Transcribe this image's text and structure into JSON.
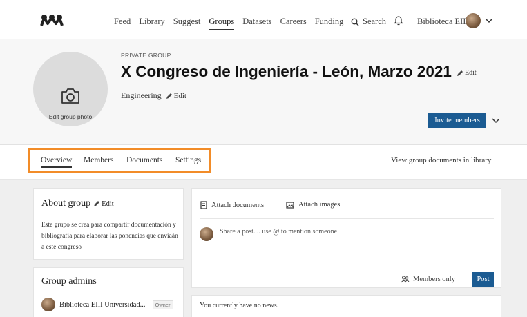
{
  "nav": {
    "links": [
      "Feed",
      "Library",
      "Suggest",
      "Groups",
      "Datasets",
      "Careers",
      "Funding"
    ],
    "active": "Groups",
    "search_label": "Search",
    "user_name": "Biblioteca EIII"
  },
  "header": {
    "photo_label": "Edit group photo",
    "privacy": "PRIVATE GROUP",
    "title": "X Congreso de Ingeniería - León, Marzo 2021",
    "title_edit": "Edit",
    "category": "Engineering",
    "category_edit": "Edit",
    "invite_label": "Invite members"
  },
  "tabs": {
    "items": [
      "Overview",
      "Members",
      "Documents",
      "Settings"
    ],
    "active": "Overview",
    "view_library": "View group documents in library",
    "highlight_color": "#f28c28"
  },
  "about": {
    "title": "About group",
    "edit": "Edit",
    "text": "Este grupo se crea para compartir documentación y bibliografía para elaborar las ponencias que enviaán a este congreso"
  },
  "admins": {
    "title": "Group admins",
    "name": "Biblioteca EIII Universidad...",
    "role": "Owner"
  },
  "post": {
    "attach_documents": "Attach documents",
    "attach_images": "Attach images",
    "placeholder": "Share a post.... use @ to mention someone",
    "visibility": "Members only",
    "submit": "Post"
  },
  "news": {
    "empty": "You currently have no news."
  },
  "colors": {
    "accent": "#1b5b92"
  }
}
